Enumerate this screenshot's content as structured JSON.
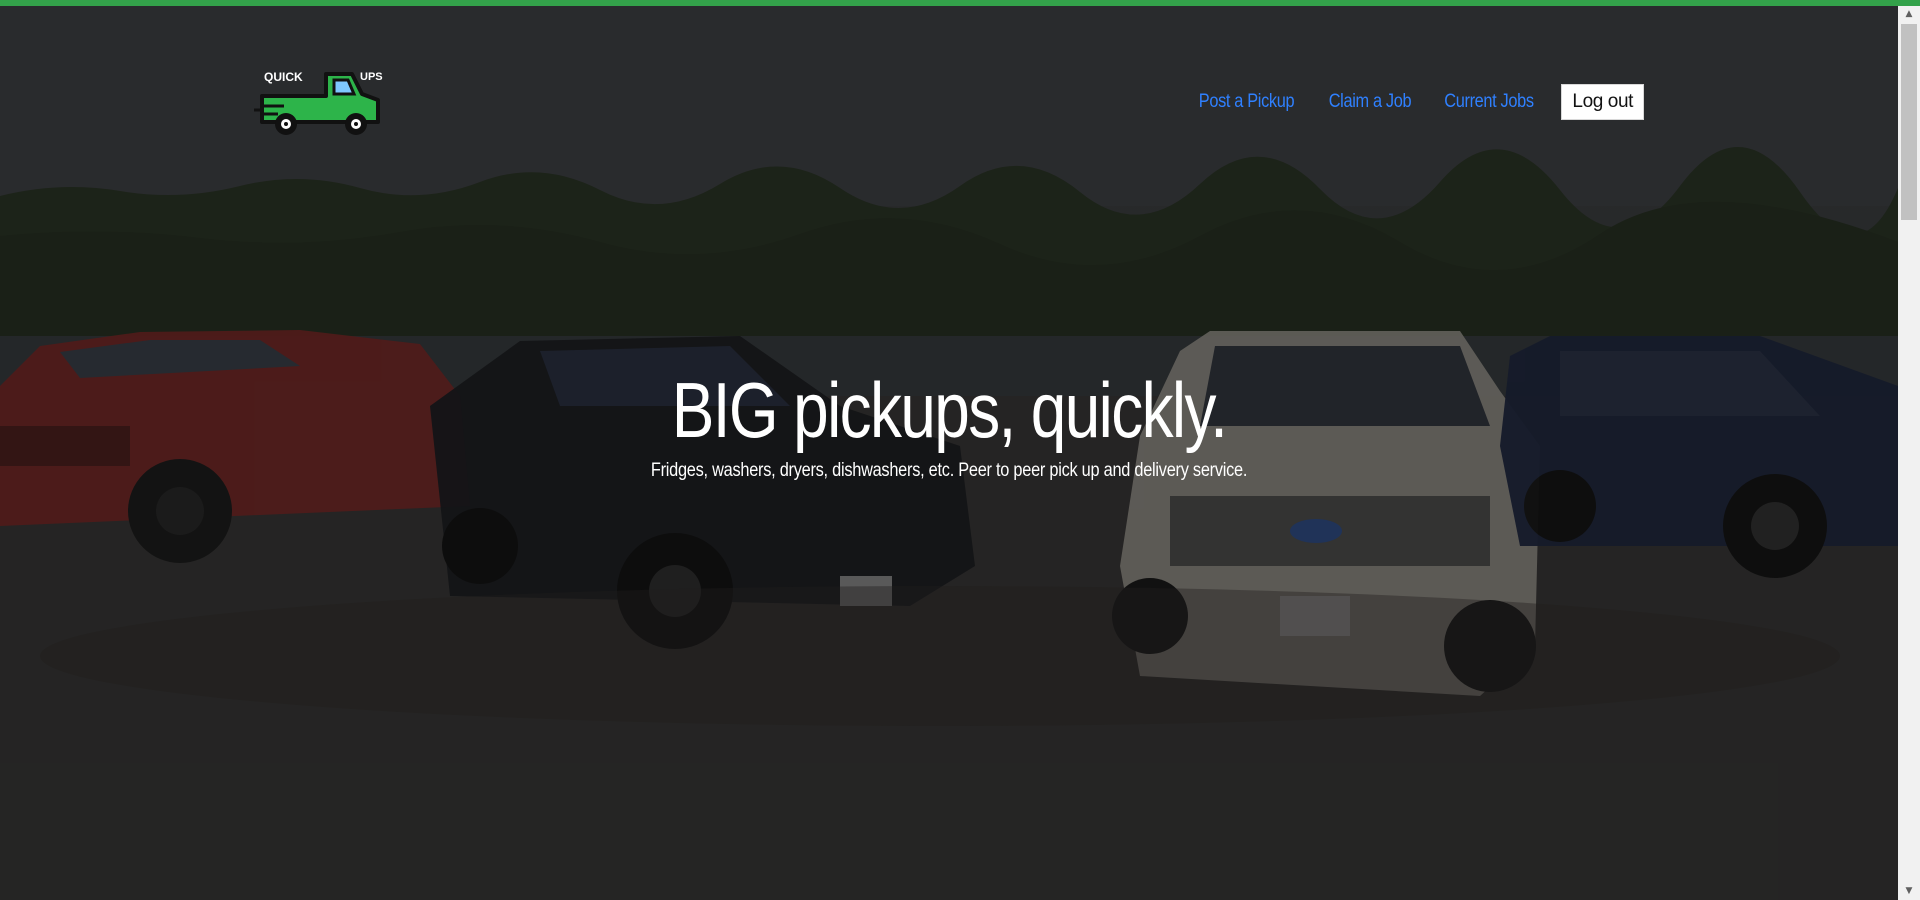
{
  "brand": {
    "logo_text_left": "QUICK",
    "logo_text_right": "UPS",
    "accent_color": "#33a24a"
  },
  "nav": {
    "links": [
      {
        "label": "Post a Pickup"
      },
      {
        "label": "Claim a Job"
      },
      {
        "label": "Current Jobs"
      }
    ],
    "logout_label": "Log out",
    "link_color": "#2f80ff"
  },
  "hero": {
    "title": "BIG pickups, quickly.",
    "subtitle": "Fridges, washers, dryers, dishwashers, etc. Peer to peer pick up and delivery service."
  },
  "scrollbar": {
    "up_arrow": "▲",
    "down_arrow": "▼"
  }
}
